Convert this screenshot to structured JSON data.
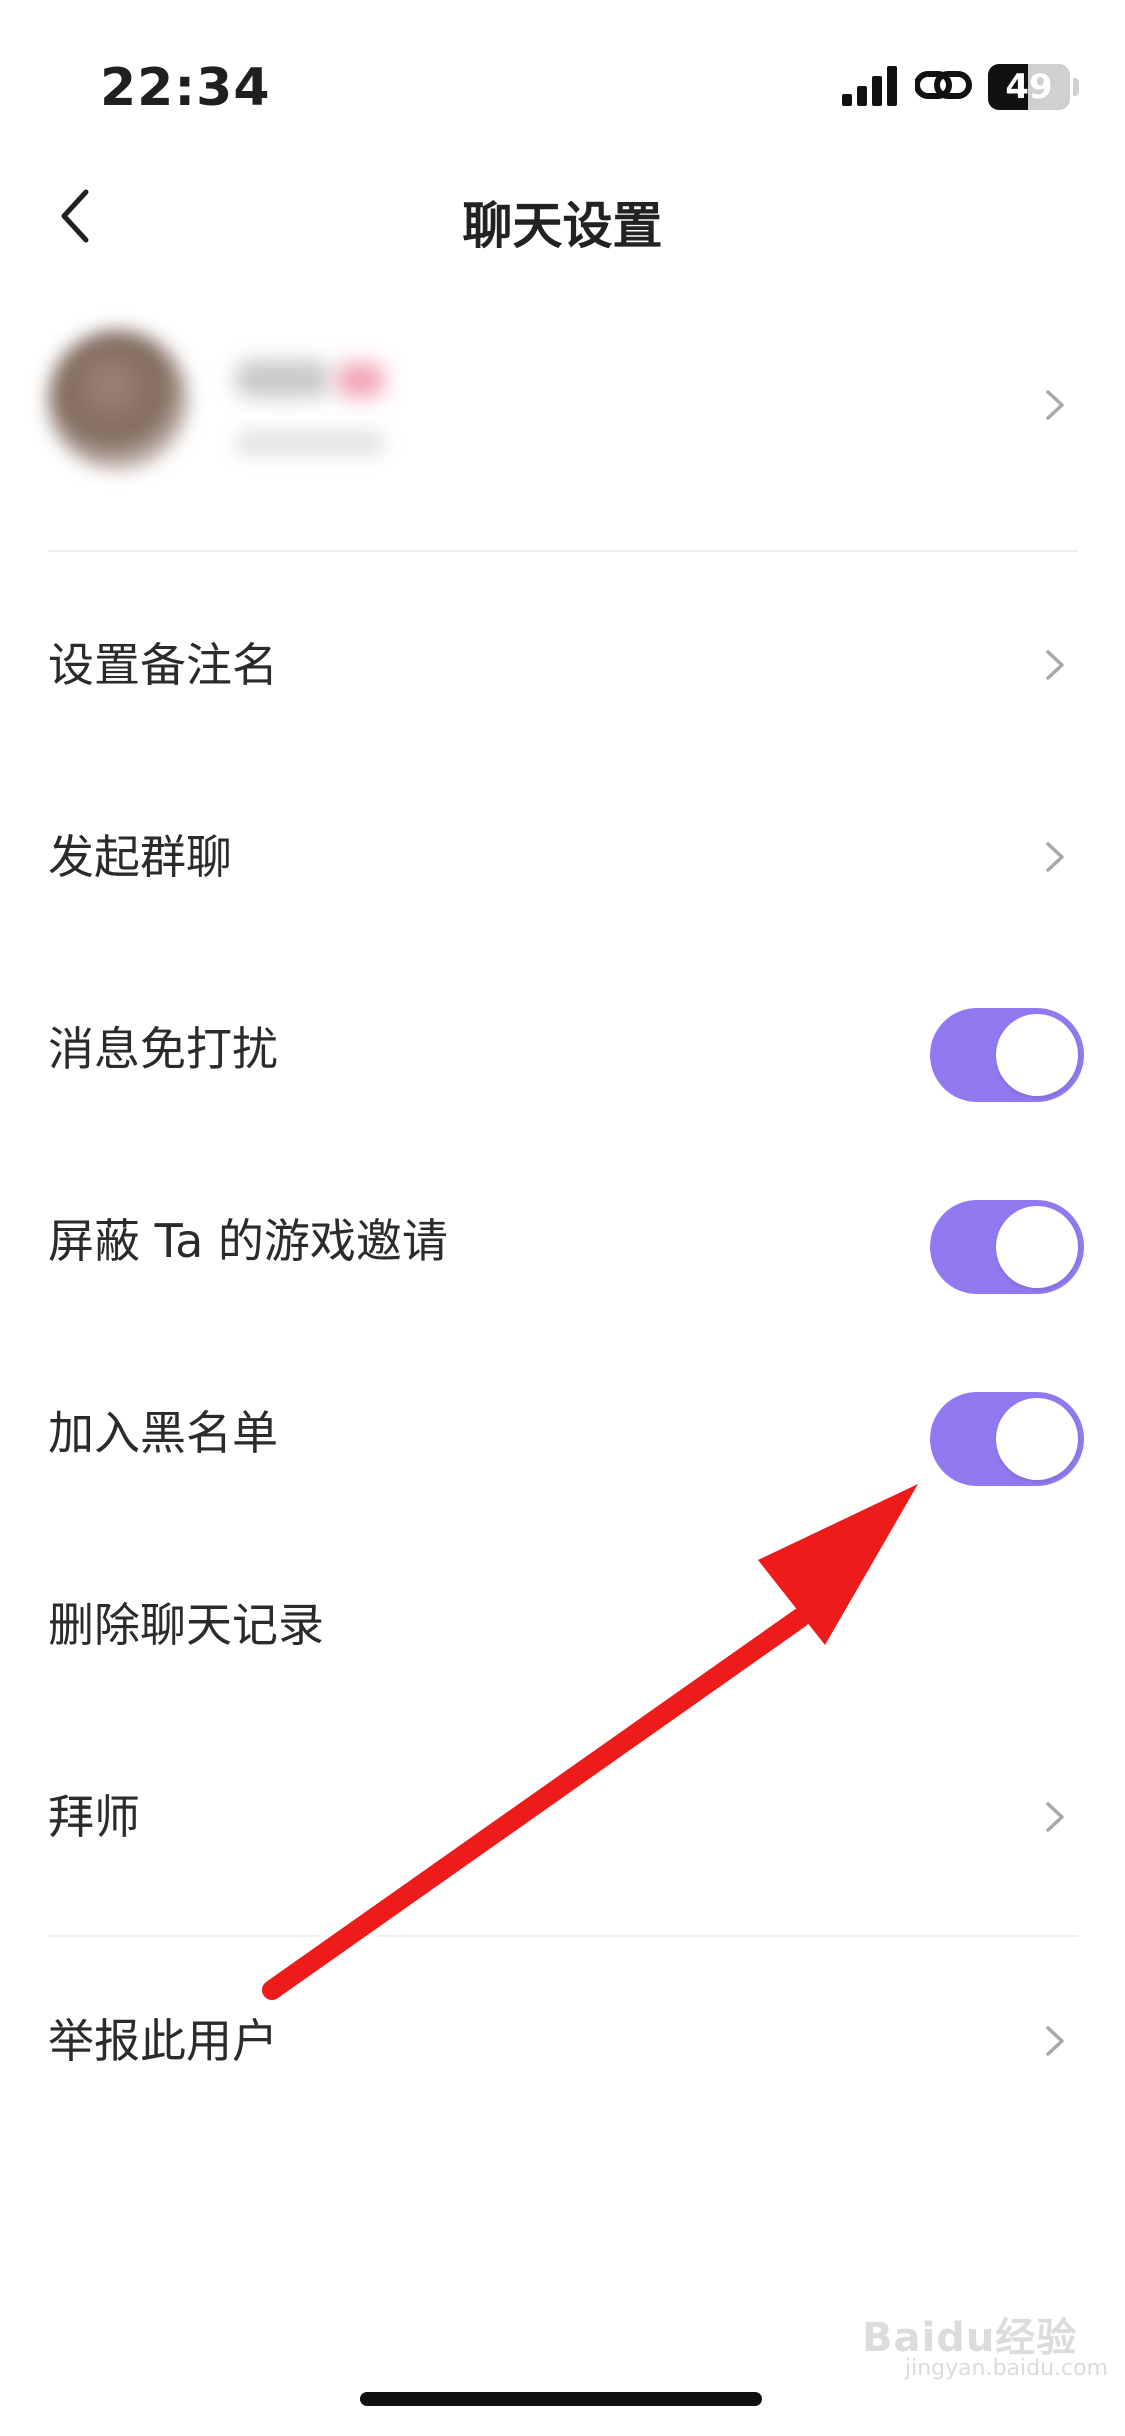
{
  "status_bar": {
    "time": "22:34",
    "battery": "49",
    "battery_level": 0.49
  },
  "nav": {
    "title": "聊天设置"
  },
  "profile": {
    "name": "",
    "subtitle": ""
  },
  "rows": [
    {
      "label": "设置备注名",
      "control": "chevron"
    },
    {
      "label": "发起群聊",
      "control": "chevron"
    },
    {
      "label": "消息免打扰",
      "control": "toggle",
      "on": true
    },
    {
      "label": "屏蔽 Ta 的游戏邀请",
      "control": "toggle",
      "on": true
    },
    {
      "label": "加入黑名单",
      "control": "toggle",
      "on": true
    },
    {
      "label": "删除聊天记录",
      "control": "none"
    },
    {
      "label": "拜师",
      "control": "chevron"
    },
    {
      "label": "举报此用户",
      "control": "chevron"
    }
  ],
  "colors": {
    "accent": "#9279f2",
    "annotation_arrow": "#ee1b1b"
  },
  "icons": [
    "back-arrow-icon",
    "chevron-right-icon",
    "signal-icon",
    "link-icon",
    "battery-icon"
  ],
  "watermark": {
    "text": "Baidu经验",
    "subtext": "jingyan.baidu.com"
  }
}
